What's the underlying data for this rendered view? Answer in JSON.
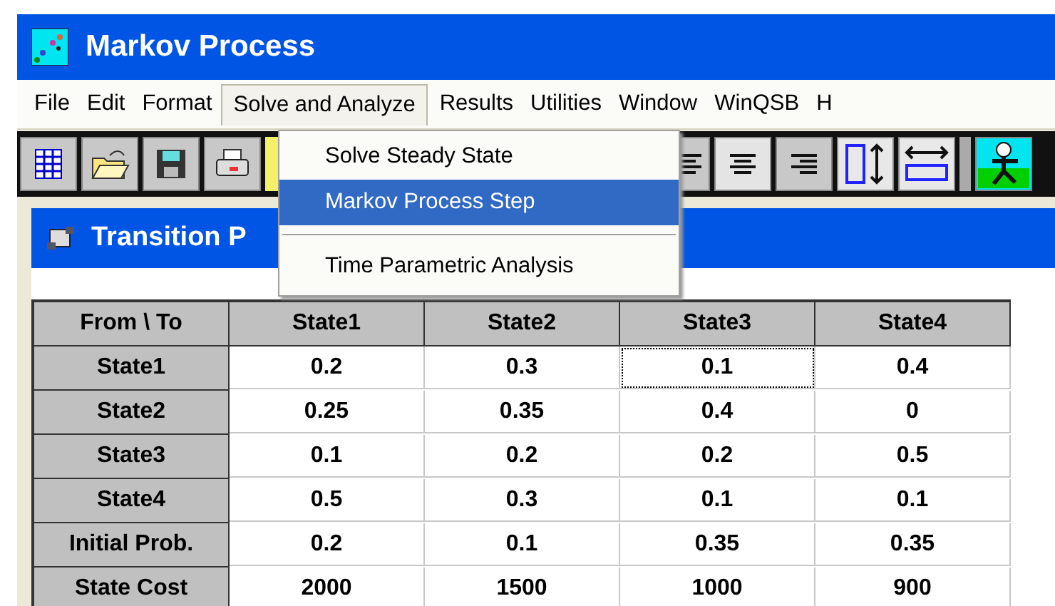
{
  "window": {
    "title": "Markov Process"
  },
  "menu_bar": [
    {
      "label": "File",
      "selected": false
    },
    {
      "label": "Edit",
      "selected": false
    },
    {
      "label": "Format",
      "selected": false
    },
    {
      "label": "Solve and Analyze",
      "selected": true
    },
    {
      "label": "Results",
      "selected": false
    },
    {
      "label": "Utilities",
      "selected": false
    },
    {
      "label": "Window",
      "selected": false
    },
    {
      "label": "WinQSB",
      "selected": false
    },
    {
      "label": "H",
      "selected": false
    }
  ],
  "dropdown": [
    {
      "kind": "item",
      "label": "Solve Steady State",
      "selected": false
    },
    {
      "kind": "item",
      "label": "Markov Process Step",
      "selected": true
    },
    {
      "kind": "separator"
    },
    {
      "kind": "item",
      "label": "Time Parametric Analysis",
      "selected": false
    }
  ],
  "inner_window": {
    "title": "Transition P"
  },
  "table": {
    "columns": [
      "From \\ To",
      "State1",
      "State2",
      "State3",
      "State4"
    ],
    "rows": [
      {
        "cells": [
          {
            "kind": "header",
            "text": "State1"
          },
          {
            "kind": "value",
            "text": "0.2",
            "focused": false
          },
          {
            "kind": "value",
            "text": "0.3",
            "focused": false
          },
          {
            "kind": "value",
            "text": "0.1",
            "focused": true
          },
          {
            "kind": "value",
            "text": "0.4",
            "focused": false
          }
        ]
      },
      {
        "cells": [
          {
            "kind": "header",
            "text": "State2"
          },
          {
            "kind": "value",
            "text": "0.25",
            "focused": false
          },
          {
            "kind": "value",
            "text": "0.35",
            "focused": false
          },
          {
            "kind": "value",
            "text": "0.4",
            "focused": false
          },
          {
            "kind": "value",
            "text": "0",
            "focused": false
          }
        ]
      },
      {
        "cells": [
          {
            "kind": "header",
            "text": "State3"
          },
          {
            "kind": "value",
            "text": "0.1",
            "focused": false
          },
          {
            "kind": "value",
            "text": "0.2",
            "focused": false
          },
          {
            "kind": "value",
            "text": "0.2",
            "focused": false
          },
          {
            "kind": "value",
            "text": "0.5",
            "focused": false
          }
        ]
      },
      {
        "cells": [
          {
            "kind": "header",
            "text": "State4"
          },
          {
            "kind": "value",
            "text": "0.5",
            "focused": false
          },
          {
            "kind": "value",
            "text": "0.3",
            "focused": false
          },
          {
            "kind": "value",
            "text": "0.1",
            "focused": false
          },
          {
            "kind": "value",
            "text": "0.1",
            "focused": false
          }
        ]
      },
      {
        "cells": [
          {
            "kind": "header",
            "text": "Initial Prob."
          },
          {
            "kind": "value",
            "text": "0.2",
            "focused": false
          },
          {
            "kind": "value",
            "text": "0.1",
            "focused": false
          },
          {
            "kind": "value",
            "text": "0.35",
            "focused": false
          },
          {
            "kind": "value",
            "text": "0.35",
            "focused": false
          }
        ]
      },
      {
        "cells": [
          {
            "kind": "header",
            "text": "State Cost"
          },
          {
            "kind": "value",
            "text": "2000",
            "focused": false
          },
          {
            "kind": "value",
            "text": "1500",
            "focused": false
          },
          {
            "kind": "value",
            "text": "1000",
            "focused": false
          },
          {
            "kind": "value",
            "text": "900",
            "focused": false
          }
        ]
      }
    ]
  }
}
